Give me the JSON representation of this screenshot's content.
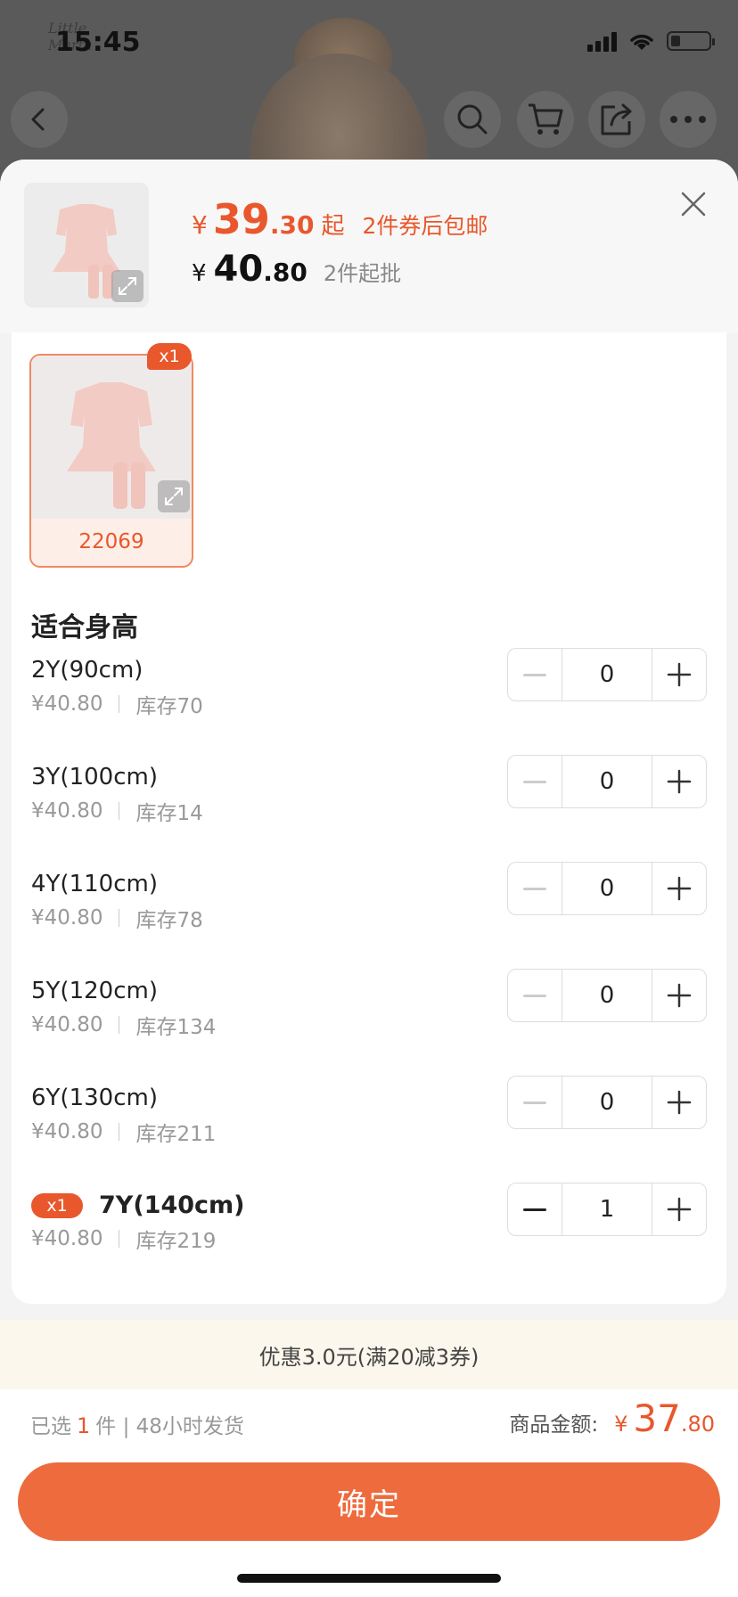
{
  "status_bar": {
    "time": "15:45",
    "brand": "Little Marta"
  },
  "sheet": {
    "price_main": {
      "symbol": "¥",
      "integer": "39",
      "decimal": ".30",
      "suffix": "起",
      "promo": "2件券后包邮"
    },
    "price_secondary": {
      "symbol": "¥",
      "integer": "40",
      "decimal": ".80",
      "min_qty": "2件起批"
    }
  },
  "variant": {
    "label": "22069",
    "badge": "x1"
  },
  "section_title": "适合身高",
  "sizes": [
    {
      "name": "2Y(90cm)",
      "price": "¥40.80",
      "stock": "库存70",
      "qty": "0"
    },
    {
      "name": "3Y(100cm)",
      "price": "¥40.80",
      "stock": "库存14",
      "qty": "0"
    },
    {
      "name": "4Y(110cm)",
      "price": "¥40.80",
      "stock": "库存78",
      "qty": "0"
    },
    {
      "name": "5Y(120cm)",
      "price": "¥40.80",
      "stock": "库存134",
      "qty": "0"
    },
    {
      "name": "6Y(130cm)",
      "price": "¥40.80",
      "stock": "库存211",
      "qty": "0"
    },
    {
      "name": "7Y(140cm)",
      "price": "¥40.80",
      "stock": "库存219",
      "qty": "1",
      "badge": "x1"
    }
  ],
  "coupon_bar": "优惠3.0元(满20减3券)",
  "summary": {
    "selected_prefix": "已选",
    "selected_count": "1",
    "selected_suffix": "件 | 48小时发货",
    "total_label": "商品金额:",
    "total_symbol": "¥",
    "total_integer": "37",
    "total_decimal": ".80"
  },
  "confirm_label": "确定",
  "colors": {
    "accent": "#e8582c",
    "button": "#ee6b3d",
    "coupon_bg": "#fbf7ec"
  },
  "icons": [
    "back-icon",
    "search-icon",
    "cart-icon",
    "share-icon",
    "more-icon",
    "close-icon",
    "expand-icon",
    "minus-icon",
    "plus-icon"
  ]
}
